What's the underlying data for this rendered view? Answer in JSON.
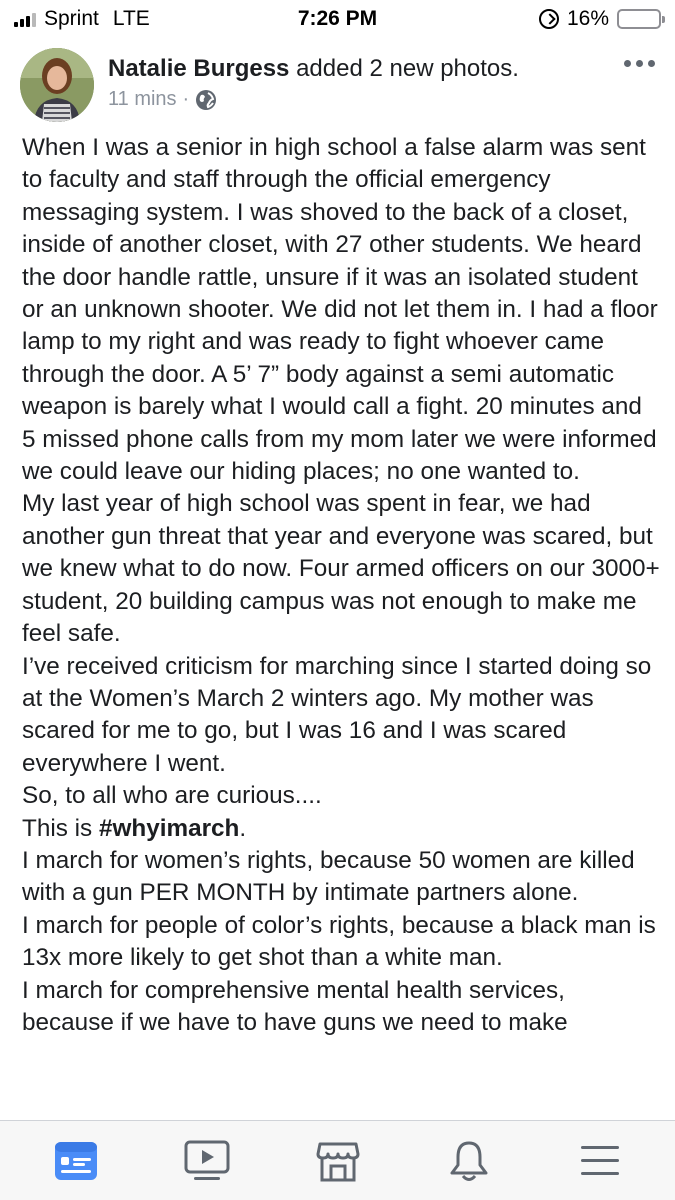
{
  "status_bar": {
    "carrier": "Sprint",
    "network": "LTE",
    "time": "7:26 PM",
    "battery_percent": "16%",
    "battery_level": 0.16,
    "battery_color": "#f5c400"
  },
  "post": {
    "author": "Natalie Burgess",
    "action": " added 2 new photos.",
    "time_ago": "11 mins",
    "separator": "·",
    "privacy_icon": "globe-icon",
    "more_icon": "more-horizontal-icon",
    "paragraphs": [
      "When I was a senior in high school a false alarm was sent to faculty and staff through the official emergency messaging system. I was shoved to the back of a closet, inside of another closet, with 27 other students. We heard the door handle rattle, unsure if it was an isolated student or an unknown shooter. We did not let them in. I had a floor lamp to my right and was ready to fight whoever came through the door. A 5’ 7” body against a semi automatic weapon is barely what I would call a fight. 20 minutes and 5 missed phone calls from my mom later we were informed we could leave our hiding places; no one wanted to.",
      "My last year of high school was spent in fear, we had another gun threat that year and everyone was scared, but we knew what to do now. Four armed officers on our 3000+ student, 20 building campus was not enough to make me feel safe.",
      "I’ve received criticism for marching since I started doing so at the Women’s March 2 winters ago. My mother was scared for me to go, but I was 16 and I was scared everywhere I went.",
      "So, to all who are curious....",
      "I march for women’s rights, because 50 women are killed with a gun PER MONTH by intimate partners alone.",
      "I march for people of color’s rights, because a black man is 13x more likely to get shot than a white man.",
      "I march for comprehensive mental health services, because if we have to have guns we need to make"
    ],
    "hashtag_prefix": "This is ",
    "hashtag": "#whyimarch",
    "hashtag_suffix": "."
  },
  "bottom_nav": {
    "items": [
      {
        "icon": "news-feed-icon",
        "active": true
      },
      {
        "icon": "watch-video-icon",
        "active": false
      },
      {
        "icon": "marketplace-icon",
        "active": false
      },
      {
        "icon": "notifications-bell-icon",
        "active": false
      },
      {
        "icon": "menu-icon",
        "active": false
      }
    ],
    "active_color": "#4a8cf7",
    "inactive_color": "#606770"
  }
}
